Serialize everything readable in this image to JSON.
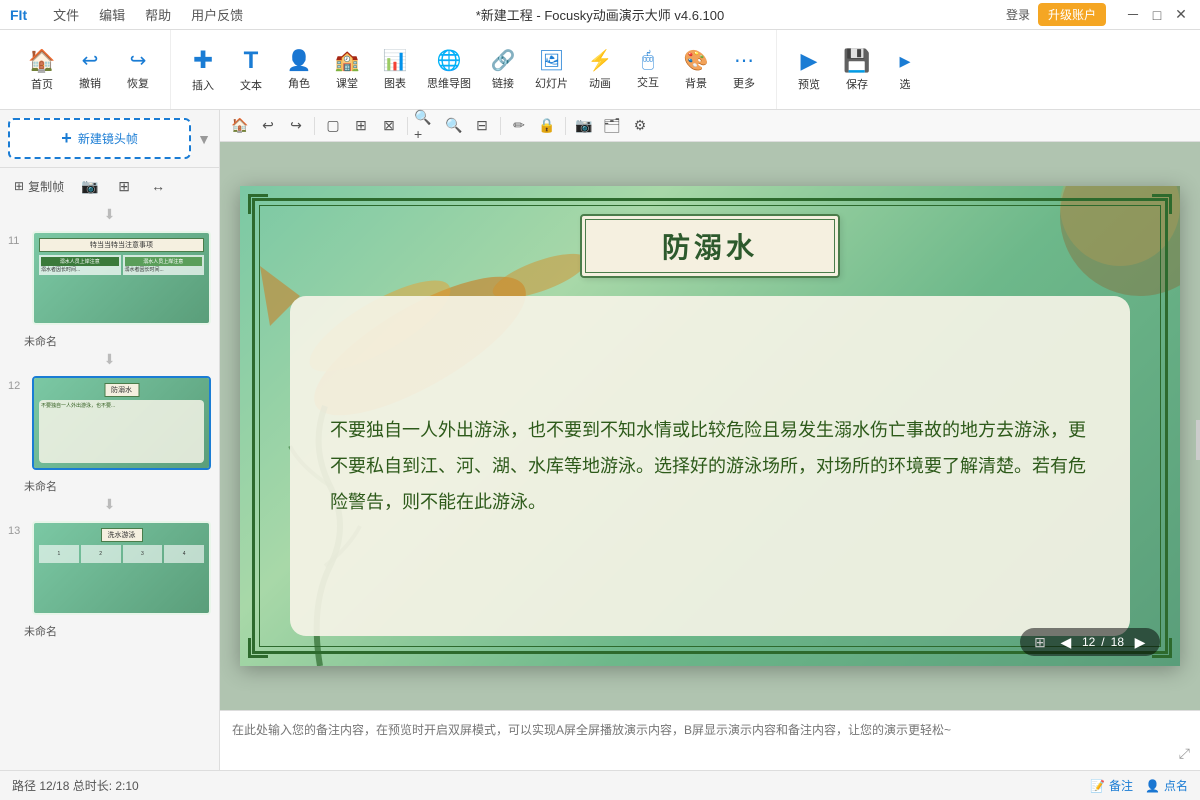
{
  "titlebar": {
    "logo": "FIt",
    "menus": [
      "文件",
      "编辑",
      "帮助",
      "用户反馈"
    ],
    "title": "*新建工程 - Focusky动画演示大师 v4.6.100",
    "login_btn": "登录",
    "upgrade_btn": "升级账户",
    "win_minimize": "－",
    "win_restore": "□",
    "win_close": "✕"
  },
  "toolbar": {
    "groups": [
      {
        "items": [
          {
            "id": "home",
            "icon": "🏠",
            "label": "首页"
          },
          {
            "id": "undo",
            "icon": "↩",
            "label": "撤销"
          },
          {
            "id": "redo",
            "icon": "↪",
            "label": "恢复"
          }
        ]
      },
      {
        "items": [
          {
            "id": "insert",
            "icon": "✚",
            "label": "插入"
          },
          {
            "id": "text",
            "icon": "T",
            "label": "文本"
          },
          {
            "id": "character",
            "icon": "👤",
            "label": "角色"
          },
          {
            "id": "classroom",
            "icon": "🏫",
            "label": "课堂"
          },
          {
            "id": "chart",
            "icon": "📊",
            "label": "图表"
          },
          {
            "id": "mindmap",
            "icon": "🧠",
            "label": "思维导图"
          },
          {
            "id": "link",
            "icon": "🔗",
            "label": "链接"
          },
          {
            "id": "slideshow",
            "icon": "🖼",
            "label": "幻灯片"
          },
          {
            "id": "animation",
            "icon": "✨",
            "label": "动画"
          },
          {
            "id": "interact",
            "icon": "🖱",
            "label": "交互"
          },
          {
            "id": "background",
            "icon": "🖼",
            "label": "背景"
          },
          {
            "id": "more",
            "icon": "⋯",
            "label": "更多"
          }
        ]
      },
      {
        "items": [
          {
            "id": "preview",
            "icon": "▶",
            "label": "预览"
          },
          {
            "id": "save",
            "icon": "💾",
            "label": "保存"
          },
          {
            "id": "more2",
            "icon": "▸",
            "label": "选"
          }
        ]
      }
    ]
  },
  "sidebar": {
    "new_frame_label": "新建镜头帧",
    "tools": [
      "复制帧",
      "📷",
      "⊞",
      "↔"
    ],
    "slides": [
      {
        "number": "11",
        "label": "未命名",
        "type": "dual-col"
      },
      {
        "number": "12",
        "label": "未命名",
        "type": "content",
        "active": true
      },
      {
        "number": "13",
        "label": "未命名",
        "type": "grid"
      }
    ]
  },
  "canvas": {
    "slide_title": "防溺水",
    "slide_content": "不要独自一人外出游泳，也不要到不知水情或比较危险且易发生溺水伤亡事故的地方去游泳，更不要私自到江、河、湖、水库等地游泳。选择好的游泳场所，对场所的环境要了解清楚。若有危险警告，则不能在此游泳。",
    "page_current": "12",
    "page_total": "18"
  },
  "canvas_toolbar": {
    "btns": [
      "🏠",
      "↩",
      "↪",
      "□",
      "⊞",
      "⊠",
      "🔍+",
      "🔍-",
      "⊟",
      "📝",
      "🔒",
      "📷",
      "🗂",
      "⚙"
    ]
  },
  "notes": {
    "placeholder": "在此处输入您的备注内容，在预览时开启双屏模式，可以实现A屏全屏播放演示内容，B屏显示演示内容和备注内容，让您的演示更轻松~"
  },
  "bottom_bar": {
    "path": "路径 12/18  总时长: 2:10",
    "note_btn": "备注",
    "point_btn": "点名"
  },
  "thumb11": {
    "title": "特当当特当注意事项",
    "col1_header": "溺水人员上岸注意",
    "col2_header": "溺水人员上岸注意",
    "col1_text": "溺水者因长时间...",
    "col2_text": "溺水者因长时间..."
  },
  "thumb12": {
    "title": "防溺水",
    "content": "不要独自一人外出游泳，也不要..."
  },
  "thumb13": {
    "title": "洗水游泳",
    "cells": [
      "1",
      "2",
      "3",
      "4"
    ]
  }
}
